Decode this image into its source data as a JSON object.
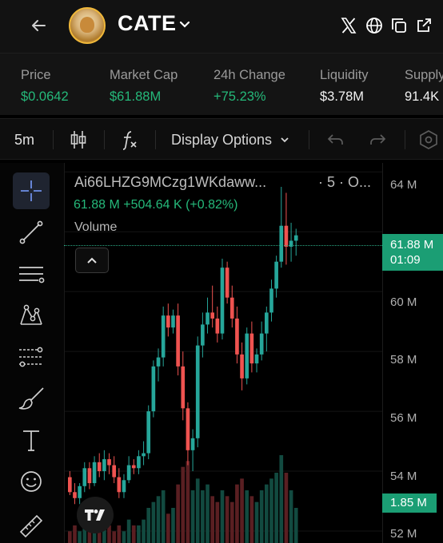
{
  "header": {
    "token_name": "CATE",
    "icons": [
      "back-arrow-icon",
      "chevron-down-icon",
      "x-icon",
      "globe-icon",
      "copy-icon",
      "external-link-icon"
    ]
  },
  "stats": [
    {
      "label": "Price",
      "value": "$0.0642",
      "color": "#25b97a"
    },
    {
      "label": "Market Cap",
      "value": "$61.88M",
      "color": "#25b97a"
    },
    {
      "label": "24h Change",
      "value": "+75.23%",
      "color": "#25b97a"
    },
    {
      "label": "Liquidity",
      "value": "$3.78M",
      "color": "#f2f2f2"
    },
    {
      "label": "Supply",
      "value": "91.4K",
      "color": "#f2f2f2"
    }
  ],
  "toolbar": {
    "interval": "5m",
    "display_options": "Display Options"
  },
  "legend": {
    "symbol": "Ai66LHZG9MCzg1WKdaww...",
    "timeframe": "· 5 · O...",
    "ohlc": "61.88 M  +504.64 K (+0.82%)",
    "volume": "Volume"
  },
  "axis": {
    "ticks": [
      "64 M",
      "60 M",
      "58 M",
      "56 M",
      "54 M",
      "52 M"
    ],
    "last_price": "61.88 M",
    "countdown": "01:09",
    "last_volume": "1.85 M"
  },
  "colors": {
    "up": "#26a69a",
    "down": "#ef5350",
    "accent": "#1b9e74"
  },
  "chart_data": {
    "type": "candlestick",
    "ylim": [
      51.6,
      64.3
    ],
    "candles": [
      [
        53.8,
        54.0,
        53.2,
        53.3
      ],
      [
        53.3,
        53.6,
        52.9,
        53.1
      ],
      [
        53.1,
        53.6,
        52.9,
        53.5
      ],
      [
        53.5,
        54.3,
        53.3,
        54.1
      ],
      [
        54.1,
        54.3,
        53.4,
        53.6
      ],
      [
        53.6,
        54.5,
        53.5,
        54.3
      ],
      [
        54.3,
        54.6,
        53.8,
        54.0
      ],
      [
        54.0,
        54.7,
        53.7,
        54.4
      ],
      [
        54.4,
        54.6,
        53.9,
        54.2
      ],
      [
        54.2,
        54.5,
        53.6,
        53.8
      ],
      [
        53.8,
        54.1,
        53.1,
        53.3
      ],
      [
        53.3,
        53.9,
        53.1,
        53.7
      ],
      [
        53.7,
        54.5,
        53.6,
        54.2
      ],
      [
        54.2,
        54.4,
        53.9,
        54.1
      ],
      [
        54.1,
        54.7,
        53.9,
        54.5
      ],
      [
        54.5,
        55.0,
        54.2,
        54.6
      ],
      [
        54.6,
        56.2,
        54.4,
        56.0
      ],
      [
        56.0,
        57.7,
        55.8,
        57.5
      ],
      [
        57.5,
        58.1,
        57.0,
        57.8
      ],
      [
        57.8,
        59.5,
        57.5,
        59.2
      ],
      [
        59.2,
        59.6,
        58.5,
        58.8
      ],
      [
        58.8,
        59.4,
        58.6,
        59.2
      ],
      [
        59.2,
        59.6,
        57.2,
        57.5
      ],
      [
        57.5,
        58.0,
        55.7,
        56.1
      ],
      [
        56.1,
        56.3,
        54.2,
        54.7
      ],
      [
        54.7,
        55.4,
        54.0,
        55.1
      ],
      [
        55.1,
        58.5,
        54.8,
        58.2
      ],
      [
        58.2,
        59.3,
        57.8,
        58.9
      ],
      [
        58.9,
        59.8,
        58.6,
        59.3
      ],
      [
        59.3,
        60.2,
        58.8,
        59.1
      ],
      [
        59.1,
        59.5,
        58.3,
        58.6
      ],
      [
        58.6,
        61.1,
        58.4,
        60.8
      ],
      [
        60.8,
        61.0,
        59.6,
        59.8
      ],
      [
        59.8,
        60.2,
        58.8,
        59.1
      ],
      [
        59.1,
        59.5,
        57.6,
        57.9
      ],
      [
        57.9,
        58.3,
        56.7,
        57.1
      ],
      [
        57.1,
        58.8,
        56.9,
        58.6
      ],
      [
        58.6,
        59.0,
        57.3,
        57.6
      ],
      [
        57.6,
        58.1,
        57.3,
        57.9
      ],
      [
        57.9,
        59.0,
        57.7,
        58.6
      ],
      [
        58.6,
        59.5,
        58.0,
        59.3
      ],
      [
        59.3,
        60.4,
        59.0,
        60.1
      ],
      [
        60.1,
        61.2,
        59.8,
        61.0
      ],
      [
        61.0,
        63.5,
        60.8,
        62.2
      ],
      [
        62.2,
        63.3,
        60.9,
        61.5
      ],
      [
        61.5,
        62.3,
        61.0,
        61.7
      ],
      [
        61.7,
        62.1,
        61.2,
        61.88
      ]
    ],
    "volume": [
      2,
      3,
      2,
      4,
      3,
      3,
      2,
      3,
      3,
      2,
      3,
      2,
      4,
      3,
      3,
      4,
      6,
      7,
      8,
      9,
      5,
      6,
      10,
      13,
      14,
      9,
      11,
      9,
      10,
      8,
      7,
      9,
      8,
      7,
      10,
      11,
      9,
      8,
      7,
      9,
      10,
      11,
      12,
      15,
      12,
      9,
      6
    ]
  }
}
